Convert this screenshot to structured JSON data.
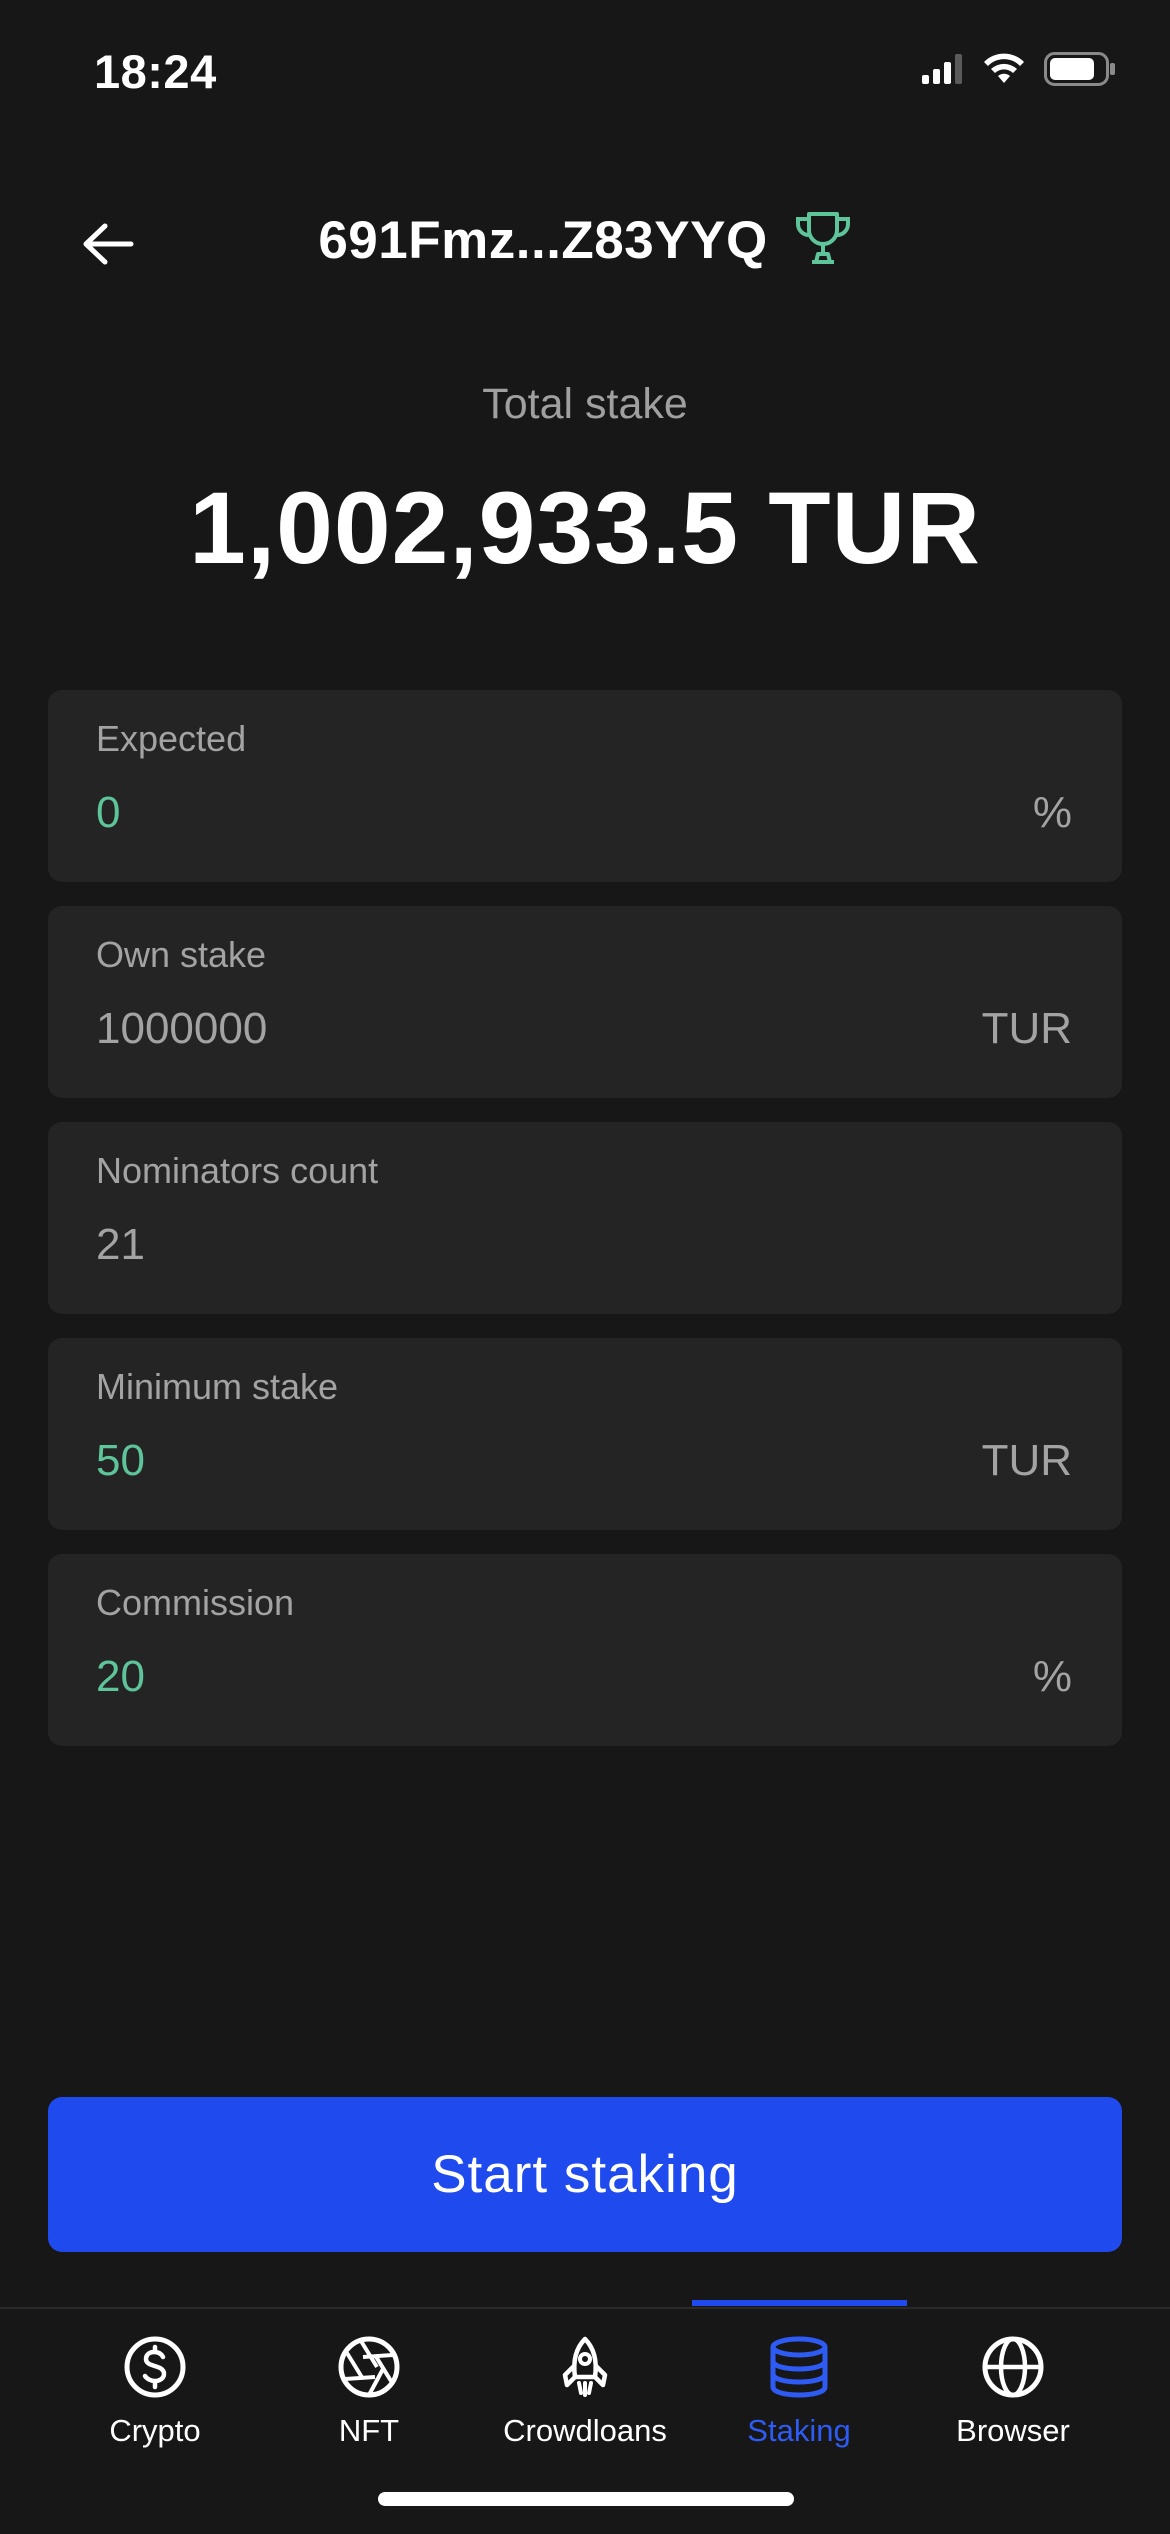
{
  "status_bar": {
    "time": "18:24"
  },
  "header": {
    "title": "691Fmz...Z83YYQ",
    "back_icon": "arrow-left-icon",
    "badge_icon": "trophy-icon",
    "badge_color": "#5ec49a"
  },
  "total_stake": {
    "label": "Total stake",
    "value": "1,002,933.5 TUR"
  },
  "fields": [
    {
      "label": "Expected",
      "value": "0",
      "unit": "%",
      "highlight": true
    },
    {
      "label": "Own stake",
      "value": "1000000",
      "unit": "TUR",
      "highlight": false
    },
    {
      "label": "Nominators count",
      "value": "21",
      "unit": "",
      "highlight": false
    },
    {
      "label": "Minimum stake",
      "value": "50",
      "unit": "TUR",
      "highlight": true
    },
    {
      "label": "Commission",
      "value": "20",
      "unit": "%",
      "highlight": true
    }
  ],
  "primary_action": {
    "label": "Start staking",
    "color": "#1f4aee"
  },
  "tabs": [
    {
      "label": "Crypto",
      "icon": "dollar-circle-icon",
      "active": false
    },
    {
      "label": "NFT",
      "icon": "aperture-icon",
      "active": false
    },
    {
      "label": "Crowdloans",
      "icon": "rocket-icon",
      "active": false
    },
    {
      "label": "Staking",
      "icon": "database-stack-icon",
      "active": true
    },
    {
      "label": "Browser",
      "icon": "globe-icon",
      "active": false
    }
  ],
  "colors": {
    "background": "#171717",
    "card": "#242424",
    "accent_green": "#5ec49a",
    "accent_blue": "#1f4aee",
    "muted_text": "#a3a3a3"
  }
}
